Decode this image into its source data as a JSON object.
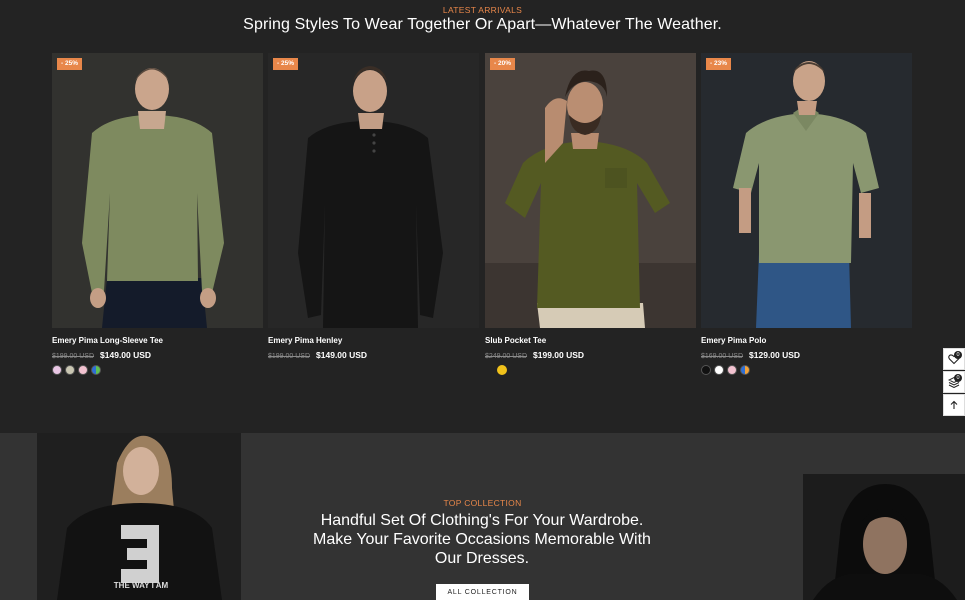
{
  "latest": {
    "eyebrow": "LATEST ARRIVALS",
    "headline": "Spring Styles To Wear Together Or Apart—Whatever The Weather."
  },
  "products": [
    {
      "badge": "- 25%",
      "name": "Emery Pima Long-Sleeve Tee",
      "old_price": "$199.00 USD",
      "price": "$149.00 USD",
      "swatches": [
        "#e9c6e4",
        "#c9c6b2",
        "#f2c2d0",
        "split-blue-green"
      ]
    },
    {
      "badge": "- 25%",
      "name": "Emery Pima Henley",
      "old_price": "$199.00 USD",
      "price": "$149.00 USD",
      "swatches": []
    },
    {
      "badge": "- 20%",
      "name": "Slub Pocket Tee",
      "old_price": "$249.00 USD",
      "price": "$199.00 USD",
      "swatches": [
        "#f1c21b"
      ]
    },
    {
      "badge": "- 23%",
      "name": "Emery Pima Polo",
      "old_price": "$169.00 USD",
      "price": "$129.00 USD",
      "swatches": [
        "#111111",
        "#ffffff",
        "#f2c2d0",
        "split-blue-orange"
      ]
    }
  ],
  "collection": {
    "eyebrow": "TOP COLLECTION",
    "line1": "Handful Set Of Clothing's For Your Wardrobe.",
    "line2": "Make Your Favorite Occasions Memorable With",
    "line3": "Our Dresses.",
    "button": "ALL COLLECTION",
    "hoodie_print": "THE WAY I AM"
  },
  "side_tools": {
    "wishlist_count": "0",
    "compare_count": "0"
  },
  "colors": {
    "accent": "#e8874a",
    "bg_dark": "#232323",
    "bg_band": "#333333"
  }
}
